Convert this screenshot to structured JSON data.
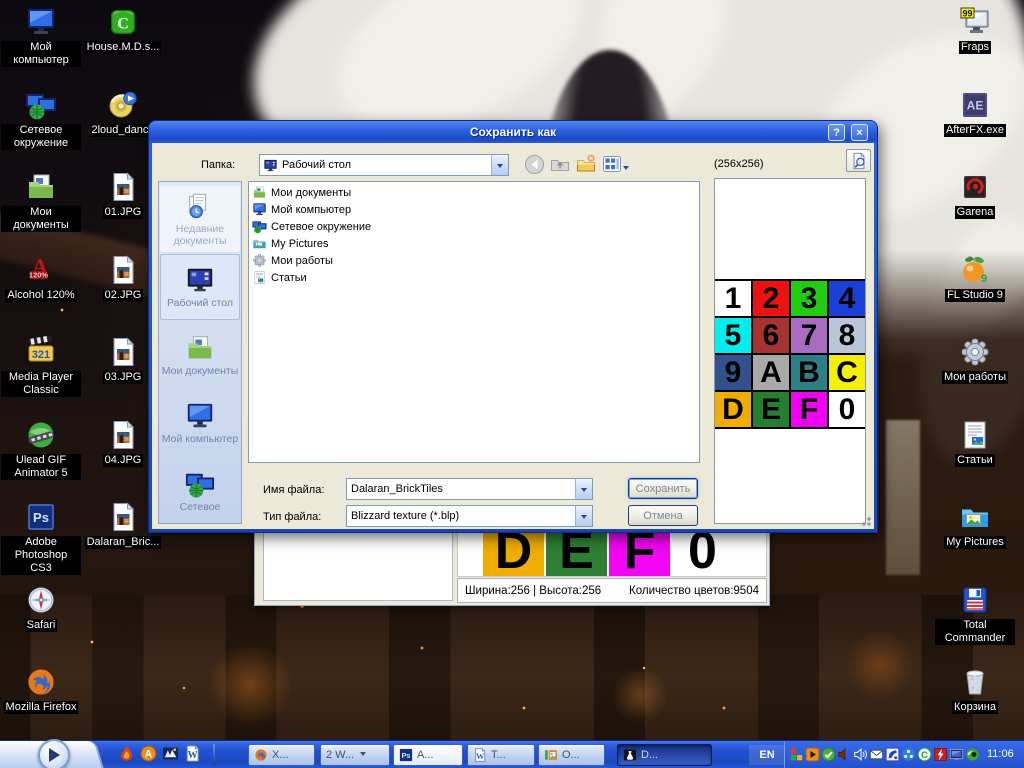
{
  "desktop": {
    "left_col1": [
      {
        "icon": "computer",
        "label": "Мой компьютер"
      },
      {
        "icon": "network",
        "label": "Сетевое окружение"
      },
      {
        "icon": "mydocs",
        "label": "Мои документы"
      },
      {
        "icon": "alcohol",
        "label": "Alcohol 120%"
      },
      {
        "icon": "mpc",
        "label": "Media Player Classic"
      },
      {
        "icon": "ulead",
        "label": "Ulead GIF Animator 5"
      },
      {
        "icon": "photoshop",
        "label": "Adobe Photoshop CS3"
      },
      {
        "icon": "safari",
        "label": "Safari"
      },
      {
        "icon": "firefox",
        "label": "Mozilla Firefox"
      }
    ],
    "left_col2": [
      {
        "icon": "torrent",
        "label": "House.M.D.s..."
      },
      {
        "icon": "cd",
        "label": "2loud_danc.."
      },
      {
        "icon": "jpg",
        "label": "01.JPG"
      },
      {
        "icon": "jpg",
        "label": "02.JPG"
      },
      {
        "icon": "jpg",
        "label": "03.JPG"
      },
      {
        "icon": "jpg",
        "label": "04.JPG"
      },
      {
        "icon": "jpg",
        "label": "Dalaran_Bric..."
      }
    ],
    "right_col": [
      {
        "icon": "fraps",
        "label": "Fraps"
      },
      {
        "icon": "afterfx",
        "label": "AfterFX.exe"
      },
      {
        "icon": "garena",
        "label": "Garena"
      },
      {
        "icon": "flstudio",
        "label": "FL Studio 9"
      },
      {
        "icon": "gear",
        "label": "Мои работы"
      },
      {
        "icon": "article",
        "label": "Статьи"
      },
      {
        "icon": "mypictures",
        "label": "My Pictures"
      },
      {
        "icon": "totalcmd",
        "label": "Total Commander"
      },
      {
        "icon": "recycle",
        "label": "Корзина"
      }
    ]
  },
  "dialog": {
    "title": "Сохранить как",
    "help_glyph": "?",
    "close_glyph": "×",
    "folder_label": "Папка:",
    "folder_value": "Рабочий стол",
    "toolbar_icons": [
      "back",
      "up-folder",
      "new-folder",
      "views"
    ],
    "size_label": "(256x256)",
    "places": [
      {
        "icon": "recent",
        "label": "Недавние документы",
        "state": "dim"
      },
      {
        "icon": "desktop-screen",
        "label": "Рабочий стол",
        "state": "selected"
      },
      {
        "icon": "mydocs",
        "label": "Мои документы",
        "state": ""
      },
      {
        "icon": "computer",
        "label": "Мой компьютер",
        "state": ""
      },
      {
        "icon": "network",
        "label": "Сетевое",
        "state": ""
      }
    ],
    "files": [
      {
        "icon": "mydocs",
        "label": "Мои документы"
      },
      {
        "icon": "computer",
        "label": "Мой компьютер"
      },
      {
        "icon": "network",
        "label": "Сетевое окружение"
      },
      {
        "icon": "mypictures",
        "label": "My Pictures"
      },
      {
        "icon": "gear",
        "label": "Мои работы"
      },
      {
        "icon": "article",
        "label": "Статьи"
      }
    ],
    "filename_label": "Имя файла:",
    "filename_value": "Dalaran_BrickTiles",
    "filetype_label": "Тип файла:",
    "filetype_value": "Blizzard texture (*.blp)",
    "save_label": "Сохранить",
    "cancel_label": "Отмена",
    "preview_grid": [
      {
        "ch": "1",
        "bg": "#ffffff"
      },
      {
        "ch": "2",
        "bg": "#ee1111"
      },
      {
        "ch": "3",
        "bg": "#22cc11"
      },
      {
        "ch": "4",
        "bg": "#1b3fd9"
      },
      {
        "ch": "5",
        "bg": "#00eeee"
      },
      {
        "ch": "6",
        "bg": "#a63232"
      },
      {
        "ch": "7",
        "bg": "#a96cc0"
      },
      {
        "ch": "8",
        "bg": "#b9c6d9"
      },
      {
        "ch": "9",
        "bg": "#31508e"
      },
      {
        "ch": "A",
        "bg": "#a9a9a9"
      },
      {
        "ch": "B",
        "bg": "#2e7f85"
      },
      {
        "ch": "C",
        "bg": "#f5ef00"
      },
      {
        "ch": "D",
        "bg": "#efad00"
      },
      {
        "ch": "E",
        "bg": "#247f2e"
      },
      {
        "ch": "F",
        "bg": "#f200f2"
      },
      {
        "ch": "0",
        "bg": "#ffffff"
      }
    ]
  },
  "bg_window": {
    "tiles": [
      {
        "ch": "D",
        "bg": "#efad00"
      },
      {
        "ch": "E",
        "bg": "#2d7f33"
      },
      {
        "ch": "F",
        "bg": "#f205f2"
      },
      {
        "ch": "0",
        "bg": "#ffffff"
      }
    ],
    "status_left": "Ширина:256 | Высота:256",
    "status_right": "Количество цветов:9504"
  },
  "taskbar": {
    "quick_launch": [
      {
        "icon": "flame"
      },
      {
        "icon": "avira-a"
      },
      {
        "icon": "media-info"
      },
      {
        "icon": "word"
      }
    ],
    "buttons": [
      {
        "icon": "firefox",
        "label": "X...",
        "style": "normal",
        "caret": false
      },
      {
        "icon": "",
        "label": "2 W...",
        "style": "normal",
        "caret": true
      },
      {
        "icon": "ps-sm",
        "label": "A...",
        "style": "light",
        "caret": false
      },
      {
        "icon": "word",
        "label": "T...",
        "style": "normal",
        "caret": false
      },
      {
        "icon": "picture-manager",
        "label": "O...",
        "style": "normal",
        "caret": false
      },
      {
        "icon": "blp-lab",
        "label": "D...",
        "style": "active",
        "caret": false
      }
    ],
    "language": "EN",
    "tray": [
      {
        "icon": "app-grid"
      },
      {
        "icon": "media-play"
      },
      {
        "icon": "antivirus-check"
      },
      {
        "icon": "volume-muted"
      },
      {
        "icon": "volume"
      },
      {
        "icon": "mail"
      },
      {
        "icon": "phone"
      },
      {
        "icon": "blue-orb"
      },
      {
        "icon": "bitcomet"
      },
      {
        "icon": "flash"
      },
      {
        "icon": "display"
      },
      {
        "icon": "nvidia"
      }
    ],
    "clock": "11:06"
  }
}
